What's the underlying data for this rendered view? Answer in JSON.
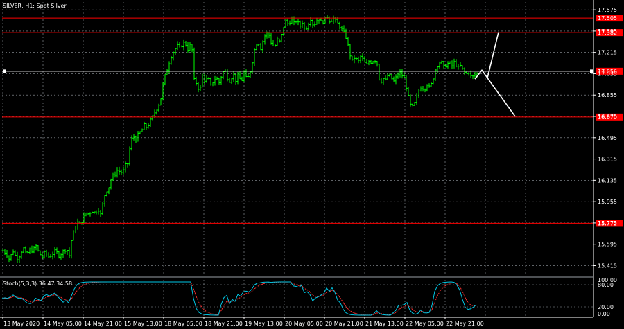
{
  "chart_data": {
    "type": "candlestick",
    "title": "SILVER, H1:  Spot Silver",
    "ylim": [
      15.33,
      17.64
    ],
    "y_ticks": [
      "17.575",
      "17.395",
      "17.215",
      "17.035",
      "16.855",
      "16.675",
      "16.495",
      "16.315",
      "16.135",
      "15.955",
      "15.775",
      "15.595",
      "15.415"
    ],
    "x_ticks": [
      "13 May 2020",
      "14 May 05:00",
      "14 May 21:00",
      "15 May 13:00",
      "18 May 05:00",
      "18 May 21:00",
      "19 May 13:00",
      "20 May 05:00",
      "20 May 21:00",
      "21 May 13:00",
      "22 May 05:00",
      "22 May 21:00"
    ],
    "price_path": [
      [
        0,
        15.54
      ],
      [
        5,
        15.52
      ],
      [
        10,
        15.46
      ],
      [
        14,
        15.55
      ],
      [
        18,
        15.5
      ],
      [
        22,
        15.47
      ],
      [
        26,
        15.53
      ],
      [
        30,
        15.56
      ],
      [
        34,
        15.5
      ],
      [
        38,
        15.55
      ],
      [
        43,
        15.54
      ],
      [
        48,
        15.58
      ],
      [
        52,
        15.52
      ],
      [
        57,
        15.49
      ],
      [
        61,
        15.53
      ],
      [
        66,
        15.49
      ],
      [
        71,
        15.51
      ],
      [
        76,
        15.54
      ],
      [
        81,
        15.5
      ],
      [
        86,
        15.53
      ],
      [
        92,
        15.56
      ],
      [
        96,
        15.5
      ],
      [
        100,
        15.67
      ],
      [
        104,
        15.72
      ],
      [
        108,
        15.78
      ],
      [
        112,
        15.76
      ],
      [
        116,
        15.82
      ],
      [
        120,
        15.86
      ],
      [
        124,
        15.85
      ],
      [
        128,
        15.88
      ],
      [
        133,
        15.86
      ],
      [
        138,
        15.89
      ],
      [
        142,
        15.83
      ],
      [
        145,
        15.98
      ],
      [
        149,
        16.04
      ],
      [
        153,
        16.08
      ],
      [
        157,
        16.16
      ],
      [
        161,
        16.18
      ],
      [
        165,
        16.22
      ],
      [
        169,
        16.21
      ],
      [
        173,
        16.2
      ],
      [
        177,
        16.26
      ],
      [
        181,
        16.28
      ],
      [
        184,
        16.46
      ],
      [
        188,
        16.51
      ],
      [
        192,
        16.48
      ],
      [
        196,
        16.53
      ],
      [
        200,
        16.55
      ],
      [
        204,
        16.6
      ],
      [
        208,
        16.58
      ],
      [
        212,
        16.63
      ],
      [
        216,
        16.67
      ],
      [
        220,
        16.72
      ],
      [
        224,
        16.76
      ],
      [
        228,
        16.83
      ],
      [
        232,
        16.98
      ],
      [
        236,
        17.05
      ],
      [
        240,
        17.13
      ],
      [
        244,
        17.2
      ],
      [
        248,
        17.24
      ],
      [
        252,
        17.27
      ],
      [
        256,
        17.25
      ],
      [
        260,
        17.3
      ],
      [
        264,
        17.28
      ],
      [
        268,
        17.23
      ],
      [
        272,
        17.32
      ],
      [
        276,
        16.98
      ],
      [
        280,
        16.95
      ],
      [
        284,
        16.88
      ],
      [
        288,
        17.02
      ],
      [
        292,
        16.97
      ],
      [
        296,
        17.0
      ],
      [
        300,
        16.93
      ],
      [
        304,
        16.98
      ],
      [
        308,
        17.0
      ],
      [
        312,
        16.96
      ],
      [
        316,
        17.03
      ],
      [
        320,
        17.07
      ],
      [
        324,
        17.0
      ],
      [
        328,
        16.97
      ],
      [
        332,
        17.04
      ],
      [
        336,
        16.98
      ],
      [
        340,
        17.02
      ],
      [
        344,
        16.96
      ],
      [
        348,
        17.05
      ],
      [
        352,
        16.98
      ],
      [
        356,
        17.03
      ],
      [
        360,
        17.14
      ],
      [
        364,
        17.27
      ],
      [
        368,
        17.31
      ],
      [
        372,
        17.25
      ],
      [
        376,
        17.33
      ],
      [
        380,
        17.38
      ],
      [
        384,
        17.36
      ],
      [
        388,
        17.28
      ],
      [
        392,
        17.26
      ],
      [
        396,
        17.32
      ],
      [
        400,
        17.3
      ],
      [
        404,
        17.42
      ],
      [
        408,
        17.48
      ],
      [
        412,
        17.45
      ],
      [
        416,
        17.5
      ],
      [
        420,
        17.46
      ],
      [
        424,
        17.49
      ],
      [
        428,
        17.43
      ],
      [
        432,
        17.47
      ],
      [
        436,
        17.4
      ],
      [
        440,
        17.45
      ],
      [
        444,
        17.5
      ],
      [
        448,
        17.44
      ],
      [
        452,
        17.48
      ],
      [
        456,
        17.5
      ],
      [
        460,
        17.46
      ],
      [
        464,
        17.49
      ],
      [
        468,
        17.52
      ],
      [
        472,
        17.47
      ],
      [
        476,
        17.51
      ],
      [
        480,
        17.48
      ],
      [
        484,
        17.45
      ],
      [
        488,
        17.42
      ],
      [
        492,
        17.38
      ],
      [
        496,
        17.33
      ],
      [
        500,
        17.21
      ],
      [
        504,
        17.14
      ],
      [
        508,
        17.18
      ],
      [
        512,
        17.13
      ],
      [
        516,
        17.18
      ],
      [
        520,
        17.15
      ],
      [
        524,
        17.1
      ],
      [
        528,
        17.14
      ],
      [
        532,
        17.13
      ],
      [
        536,
        17.16
      ],
      [
        540,
        17.12
      ],
      [
        544,
        16.95
      ],
      [
        548,
        17.0
      ],
      [
        552,
        16.98
      ],
      [
        556,
        17.03
      ],
      [
        560,
        17.0
      ],
      [
        564,
        16.97
      ],
      [
        568,
        17.01
      ],
      [
        572,
        17.05
      ],
      [
        576,
        17.02
      ],
      [
        580,
        16.99
      ],
      [
        584,
        16.86
      ],
      [
        588,
        16.77
      ],
      [
        592,
        16.75
      ],
      [
        596,
        16.82
      ],
      [
        600,
        16.89
      ],
      [
        604,
        16.93
      ],
      [
        608,
        16.9
      ],
      [
        612,
        16.95
      ],
      [
        616,
        16.91
      ],
      [
        620,
        16.98
      ],
      [
        624,
        17.07
      ],
      [
        628,
        17.12
      ],
      [
        632,
        17.14
      ],
      [
        636,
        17.09
      ],
      [
        640,
        17.11
      ],
      [
        644,
        17.13
      ],
      [
        648,
        17.1
      ],
      [
        652,
        17.14
      ],
      [
        656,
        17.08
      ],
      [
        660,
        17.1
      ],
      [
        664,
        17.06
      ],
      [
        668,
        17.03
      ],
      [
        672,
        17.05
      ],
      [
        676,
        17.0
      ],
      [
        680,
        17.02
      ],
      [
        684,
        17.04
      ]
    ],
    "horizontal_lines": [
      {
        "price": 17.505,
        "label": "17.505",
        "color": "#ff0000"
      },
      {
        "price": 17.382,
        "label": "17.382",
        "color": "#ff0000"
      },
      {
        "price": 17.056,
        "label": "17.056",
        "color": "#ffffff"
      },
      {
        "price": 16.67,
        "label": "16.670",
        "color": "#ff0000"
      },
      {
        "price": 15.772,
        "label": "15.772",
        "color": "#ff0000"
      }
    ],
    "projection_path": [
      [
        682,
        16.99
      ],
      [
        692,
        17.065
      ],
      [
        700,
        17.0
      ],
      [
        716,
        17.385
      ]
    ],
    "projection_path_2": [
      [
        700,
        17.0
      ],
      [
        740,
        16.675
      ]
    ],
    "indicator": {
      "label": "Stoch(5,3,3) 36.47 34.58",
      "levels": [
        "100.00",
        "80.00",
        "20.00",
        "0.00"
      ],
      "main_color": "#00c8e6",
      "signal_color": "#ff3030"
    },
    "colors": {
      "background": "#000000",
      "grid": "#9aa0a6",
      "bars": "#00ff00",
      "axis_text": "#ffffff"
    }
  }
}
